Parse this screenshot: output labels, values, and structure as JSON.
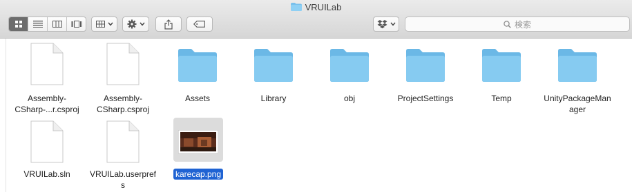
{
  "window": {
    "title": "VRUILab"
  },
  "toolbar": {
    "view_modes": [
      "icon-view",
      "list-view",
      "column-view",
      "gallery-view"
    ],
    "active_view": "icon-view",
    "search_placeholder": "検索"
  },
  "files": [
    {
      "name": "Assembly-\nCSharp-...r.csproj",
      "line1": "Assembly-",
      "line2": "CSharp-...r.csproj",
      "kind": "document"
    },
    {
      "name": "Assembly-CSharp.csproj",
      "line1": "Assembly-",
      "line2": "CSharp.csproj",
      "kind": "document"
    },
    {
      "name": "Assets",
      "line1": "Assets",
      "line2": "",
      "kind": "folder"
    },
    {
      "name": "Library",
      "line1": "Library",
      "line2": "",
      "kind": "folder"
    },
    {
      "name": "obj",
      "line1": "obj",
      "line2": "",
      "kind": "folder"
    },
    {
      "name": "ProjectSettings",
      "line1": "ProjectSettings",
      "line2": "",
      "kind": "folder"
    },
    {
      "name": "Temp",
      "line1": "Temp",
      "line2": "",
      "kind": "folder"
    },
    {
      "name": "UnityPackageManager",
      "line1": "UnityPackageMan",
      "line2": "ager",
      "kind": "folder"
    },
    {
      "name": "VRUILab.sln",
      "line1": "VRUILab.sln",
      "line2": "",
      "kind": "document"
    },
    {
      "name": "VRUILab.userprefs",
      "line1": "VRUILab.userpref",
      "line2": "s",
      "kind": "document"
    },
    {
      "name": "karecap.png",
      "line1": "karecap.png",
      "line2": "",
      "kind": "image",
      "selected": true
    }
  ],
  "colors": {
    "folder": "#7cc4ee",
    "folder_tab": "#6bb8e6",
    "selection": "#1f63d3"
  }
}
